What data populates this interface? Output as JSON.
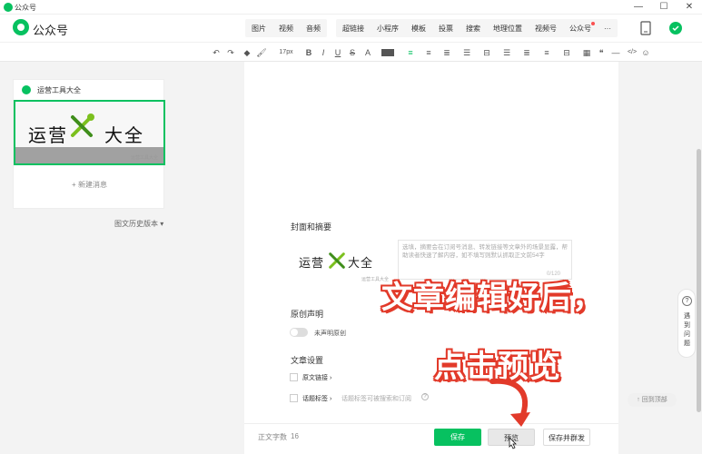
{
  "window": {
    "title": "公众号",
    "minimize": "—",
    "maximize": "☐",
    "close": "✕"
  },
  "brand": {
    "name": "公众号"
  },
  "insert_groups": [
    [
      "图片",
      "视频",
      "音频"
    ],
    [
      "超链接",
      "小程序",
      "模板",
      "投票",
      "搜索",
      "地理位置",
      "视频号",
      "公众号",
      "···"
    ]
  ],
  "toolbar": {
    "undo": "↶",
    "redo": "↷",
    "clear_format": "◆",
    "format_painter": "🖌",
    "font_size": "17px",
    "bold": "B",
    "italic": "I",
    "underline": "U",
    "strike": "S",
    "font_color": "A",
    "align": "≡",
    "more_align": "≡",
    "line_spacing": "≣",
    "list": "☰",
    "divider_1": "⊟",
    "table": "▦",
    "quote": "❝",
    "hr": "—",
    "code": "</>",
    "emoji": "☺"
  },
  "left_panel": {
    "account_name": "运营工具大全",
    "cover_text": "运营",
    "cover_text2": "大全",
    "cover_mark": "运营工具大全",
    "new_message": "+ 新建消息",
    "history": "图文历史版本 ▾"
  },
  "editor": {
    "cover_section": "封面和摘要",
    "cover_text": "运营",
    "cover_text2": "大全",
    "cover_mark": "运营工具大全",
    "summary_placeholder": "选填，摘要会在订阅号消息、转发链接等文章外的场景显露，帮助读者快速了解内容，如不填写则默认抓取正文前54字",
    "summary_count": "0/120",
    "original_section": "原创声明",
    "original_toggle_label": "未声明原创",
    "settings_section": "文章设置",
    "original_link": "原文链接 ›",
    "topic_tag": "话题标签 ›",
    "topic_hint": "话题标签可被搜索和订阅",
    "help_mark": "?"
  },
  "bottom": {
    "word_count_label": "正文字数",
    "word_count": "16",
    "save": "保存",
    "preview": "预览",
    "save_and_mass": "保存并群发"
  },
  "right": {
    "help_q": "?",
    "help_text": "遇到问题",
    "back_top": "↑ 回到顶部"
  },
  "captions": {
    "line1": "文章编辑好后，",
    "line2": "点击预览"
  },
  "colors": {
    "brand_green": "#07c160",
    "caption_red": "#e23a2a"
  }
}
